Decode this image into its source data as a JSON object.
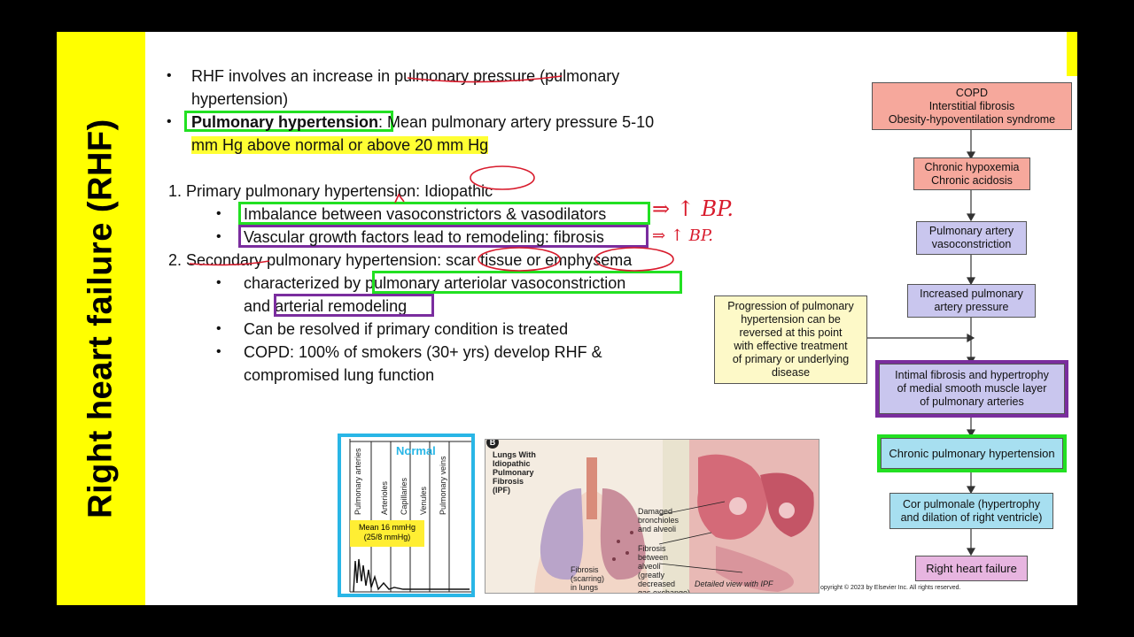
{
  "side_title": "Right heart failure (RHF)",
  "bullets": {
    "b1_line1": "RHF involves an increase in pulmonary pressure (pulmonary",
    "b1_line2": "hypertension)",
    "b2_term": "Pulmonary hypertension",
    "b2_rest": ": Mean pulmonary artery pressure 5-10",
    "b2_line2": "mm Hg above normal or above 20 mm Hg",
    "p1": "1.  Primary pulmonary hypertension: Idiopathic",
    "p1_a": "Imbalance between vasoconstrictors & vasodilators",
    "p1_b": "Vascular growth factors lead to remodeling: fibrosis",
    "p2": "2.  Secondary pulmonary hypertension: scar tissue or emphysema",
    "p2_a_pre": "characterized by",
    "p2_a_box": "pulmonary arteriolar vasoconstriction",
    "p2_a2_pre": "and",
    "p2_a2_box": "arterial remodeling",
    "p2_b": "Can be resolved if primary condition is treated",
    "p2_c1": "COPD: 100% of smokers (30+ yrs) develop RHF &",
    "p2_c2": "compromised lung function"
  },
  "annotations": {
    "ink1": "⇒ ↑ BP.",
    "ink2": "⇒ ↑ BP."
  },
  "flowchart": {
    "nodes": [
      {
        "text": "COPD\nInterstitial fibrosis\nObesity-hypoventilation syndrome",
        "color": "#f6a89c"
      },
      {
        "text": "Chronic hypoxemia\nChronic acidosis",
        "color": "#f6a89c"
      },
      {
        "text": "Pulmonary artery\nvasoconstriction",
        "color": "#c9c6ee"
      },
      {
        "text": "Increased pulmonary\nartery pressure",
        "color": "#c9c6ee"
      },
      {
        "text": "Intimal fibrosis and hypertrophy\nof medial smooth muscle layer\nof pulmonary arteries",
        "color": "#c9c6ee"
      },
      {
        "text": "Chronic pulmonary hypertension",
        "color": "#a7dff0"
      },
      {
        "text": "Cor pulmonale (hypertrophy\nand dilation of right ventricle)",
        "color": "#a7dff0"
      },
      {
        "text": "Right heart failure",
        "color": "#e7b5e0"
      }
    ],
    "note": "Progression of pulmonary\nhypertension can be\nreversed at this point\nwith effective treatment\nof primary or underlying\ndisease",
    "note_color": "#fdf9c8"
  },
  "figure_a": {
    "title": "Normal",
    "columns": [
      "Pulmonary arteries",
      "Arterioles",
      "Capillaries",
      "Venules",
      "Pulmonary veins"
    ],
    "mean_line1": "Mean 16 mmHg",
    "mean_line2": "(25/8 mmHg)"
  },
  "figure_b": {
    "badge": "B",
    "title": "Lungs With\nIdiopathic\nPulmonary\nFibrosis\n(IPF)",
    "label_damaged": "Damaged\nbronchioles\nand alveoli",
    "label_fibrosis_between": "Fibrosis\nbetween\nalveoli\n(greatly\ndecreased\ngas exchange)",
    "label_fibrosis": "Fibrosis\n(scarring)\nin lungs",
    "label_detail": "Detailed view with IPF"
  },
  "copyright": "opyright © 2023 by Elsevier Inc. All rights reserved."
}
